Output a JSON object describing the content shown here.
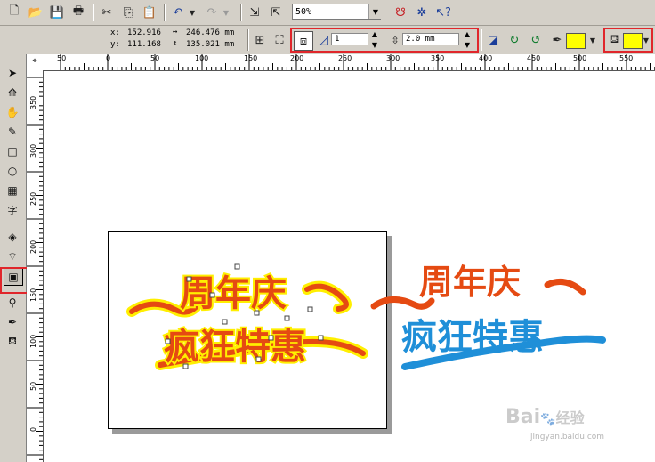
{
  "toolbar": {
    "zoom_value": "50%"
  },
  "property_bar": {
    "x_label": "x:",
    "y_label": "y:",
    "x_value": "152.916",
    "y_value": "111.168",
    "width_value": "246.476 mm",
    "height_value": "135.021 mm",
    "steps_value": "1",
    "offset_value": "2.0 mm"
  },
  "colors": {
    "outline_color": "#ffff00",
    "fill_color": "#ffff00",
    "highlight": "#e0262b"
  },
  "ruler_h_labels": [
    "50",
    "0",
    "50",
    "100",
    "150",
    "200",
    "250",
    "300",
    "350",
    "400",
    "450",
    "500",
    "550"
  ],
  "ruler_v_labels": [
    "350",
    "300",
    "250",
    "200",
    "150",
    "100",
    "50",
    "0"
  ],
  "artwork": {
    "line1": "周年庆",
    "line2": "疯狂特惠"
  },
  "watermark": {
    "brand": "Bai",
    "brand_suffix": "经验",
    "url": "jingyan.baidu.com"
  }
}
